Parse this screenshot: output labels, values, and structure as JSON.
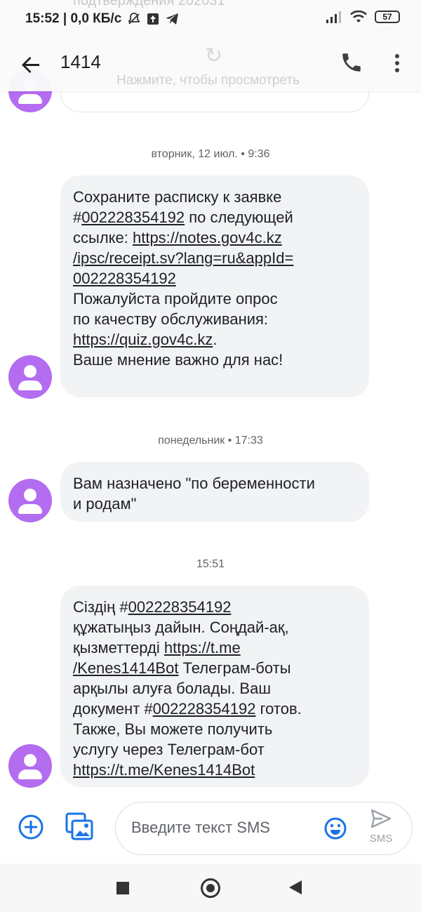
{
  "status_bar": {
    "time_speed": "15:52 | 0,0 КБ/с",
    "battery": "57",
    "ghost_text": "подтверждения 202031"
  },
  "app_bar": {
    "title": "1414",
    "ghost_hint": "Нажмите, чтобы просмотреть"
  },
  "messages": [
    {
      "timestamp": "вторник, 12 июл. • 9:36",
      "lines": [
        {
          "parts": [
            {
              "t": "Сохраните расписку к заявке"
            }
          ]
        },
        {
          "parts": [
            {
              "t": "#"
            },
            {
              "t": "002228354192",
              "link": true
            },
            {
              "t": " по следующей"
            }
          ]
        },
        {
          "parts": [
            {
              "t": "ссылке: "
            },
            {
              "t": "https://notes.gov4c.kz",
              "link": true
            }
          ]
        },
        {
          "parts": [
            {
              "t": "/ipsc/receipt.sv?lang=ru&appId=",
              "link": true
            }
          ]
        },
        {
          "parts": [
            {
              "t": "002228354192",
              "link": true
            }
          ]
        },
        {
          "parts": [
            {
              "t": " "
            }
          ]
        },
        {
          "parts": [
            {
              "t": "Пожалуйста пройдите опрос"
            }
          ]
        },
        {
          "parts": [
            {
              "t": "по качеству обслуживания:"
            }
          ]
        },
        {
          "parts": [
            {
              "t": "https://quiz.gov4c.kz",
              "link": true
            },
            {
              "t": "."
            }
          ]
        },
        {
          "parts": [
            {
              "t": "Ваше мнение важно для нас!"
            }
          ]
        }
      ]
    },
    {
      "timestamp": "понедельник • 17:33",
      "lines": [
        {
          "parts": [
            {
              "t": "Вам назначено \"по беременности"
            }
          ]
        },
        {
          "parts": [
            {
              "t": "и родам\""
            }
          ]
        }
      ]
    },
    {
      "timestamp": "15:51",
      "lines": [
        {
          "parts": [
            {
              "t": "Сіздің  #"
            },
            {
              "t": "002228354192",
              "link": true
            }
          ]
        },
        {
          "parts": [
            {
              "t": "құжатыңыз дайын. Соңдай-ақ,"
            }
          ]
        },
        {
          "parts": [
            {
              "t": "қызметтерді "
            },
            {
              "t": "https://t.me",
              "link": true
            }
          ]
        },
        {
          "parts": [
            {
              "t": "/Kenes1414Bot",
              "link": true
            },
            {
              "t": " Телеграм-боты"
            }
          ]
        },
        {
          "parts": [
            {
              "t": "арқылы алуға болады. Ваш"
            }
          ]
        },
        {
          "parts": [
            {
              "t": "документ #"
            },
            {
              "t": "002228354192",
              "link": true
            },
            {
              "t": " готов."
            }
          ]
        },
        {
          "parts": [
            {
              "t": "Также, Вы можете получить"
            }
          ]
        },
        {
          "parts": [
            {
              "t": "услугу через Телеграм-бот"
            }
          ]
        },
        {
          "parts": [
            {
              "t": "https://t.me/Kenes1414Bot",
              "link": true
            }
          ]
        }
      ]
    }
  ],
  "compose": {
    "placeholder": "Введите текст SMS",
    "send_label": "SMS"
  },
  "colors": {
    "avatar": "#b46cf0",
    "accent": "#1a73e8",
    "bubble": "#f1f3f4"
  }
}
